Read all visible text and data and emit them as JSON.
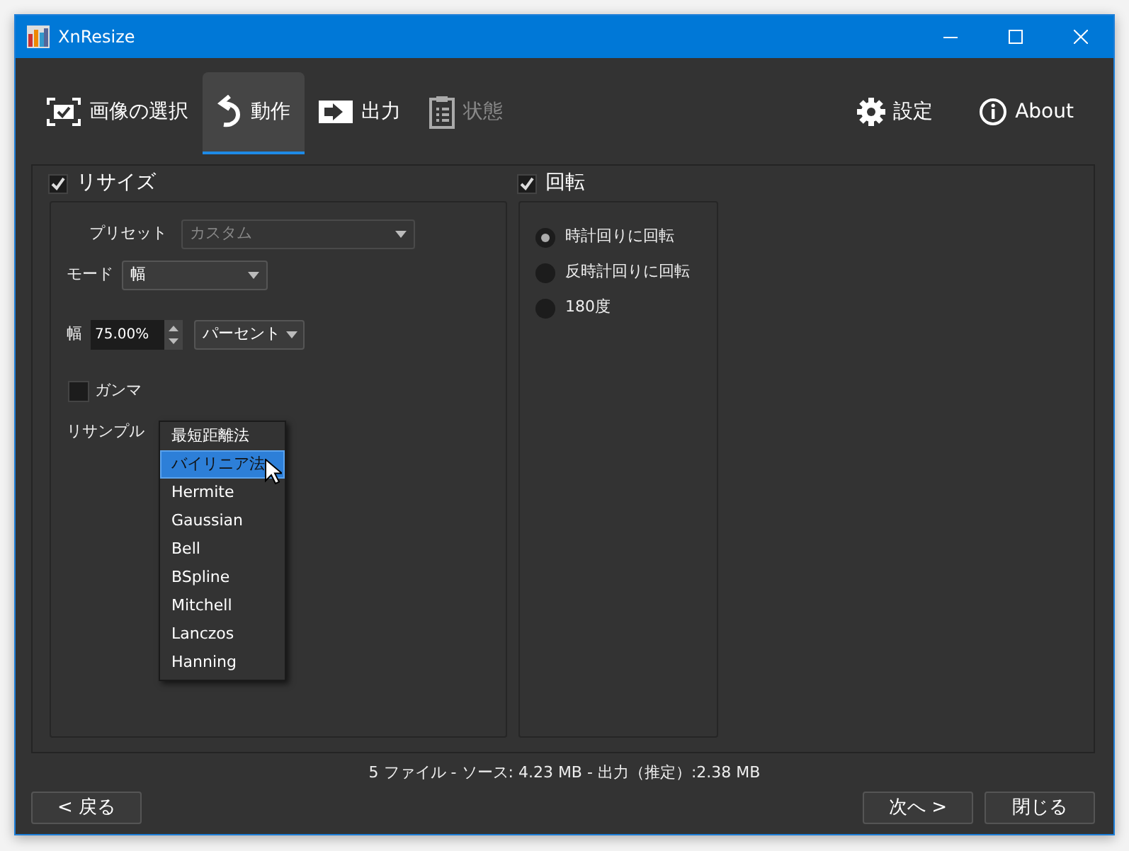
{
  "window": {
    "title": "XnResize"
  },
  "tabs": [
    {
      "label": "画像の選択",
      "kind": "select",
      "selected": false,
      "disabled": false
    },
    {
      "label": "動作",
      "kind": "action",
      "selected": true,
      "disabled": false
    },
    {
      "label": "出力",
      "kind": "output",
      "selected": false,
      "disabled": false
    },
    {
      "label": "状態",
      "kind": "status",
      "selected": false,
      "disabled": true
    }
  ],
  "toolbar_buttons": [
    {
      "label": "設定",
      "kind": "settings"
    },
    {
      "label": "About",
      "kind": "about"
    }
  ],
  "resize": {
    "label": "リサイズ",
    "checked": true,
    "preset": {
      "label": "プリセット",
      "value": "カスタム",
      "disabled": true
    },
    "mode": {
      "label": "モード",
      "value": "幅"
    },
    "width": {
      "label": "幅",
      "value": "75.00%",
      "unit": "パーセント"
    },
    "gamma": {
      "label": "ガンマ",
      "checked": false
    },
    "resample": {
      "label": "リサンプル",
      "options": [
        {
          "label": "最短距離法",
          "selected": false
        },
        {
          "label": "バイリニア法",
          "selected": true
        },
        {
          "label": "Hermite",
          "selected": false
        },
        {
          "label": "Gaussian",
          "selected": false
        },
        {
          "label": "Bell",
          "selected": false
        },
        {
          "label": "BSpline",
          "selected": false
        },
        {
          "label": "Mitchell",
          "selected": false
        },
        {
          "label": "Lanczos",
          "selected": false
        },
        {
          "label": "Hanning",
          "selected": false
        }
      ]
    }
  },
  "rotate": {
    "label": "回転",
    "checked": true,
    "options": [
      {
        "label": "時計回りに回転",
        "selected": true
      },
      {
        "label": "反時計回りに回転",
        "selected": false
      },
      {
        "label": "180度",
        "selected": false
      }
    ]
  },
  "status_bar": "5 ファイル - ソース: 4.23 MB - 出力（推定）:2.38 MB",
  "left_buttons": [
    {
      "label": "< 戻る"
    }
  ],
  "right_buttons": [
    {
      "label": "次へ >"
    },
    {
      "label": "閉じる"
    }
  ]
}
